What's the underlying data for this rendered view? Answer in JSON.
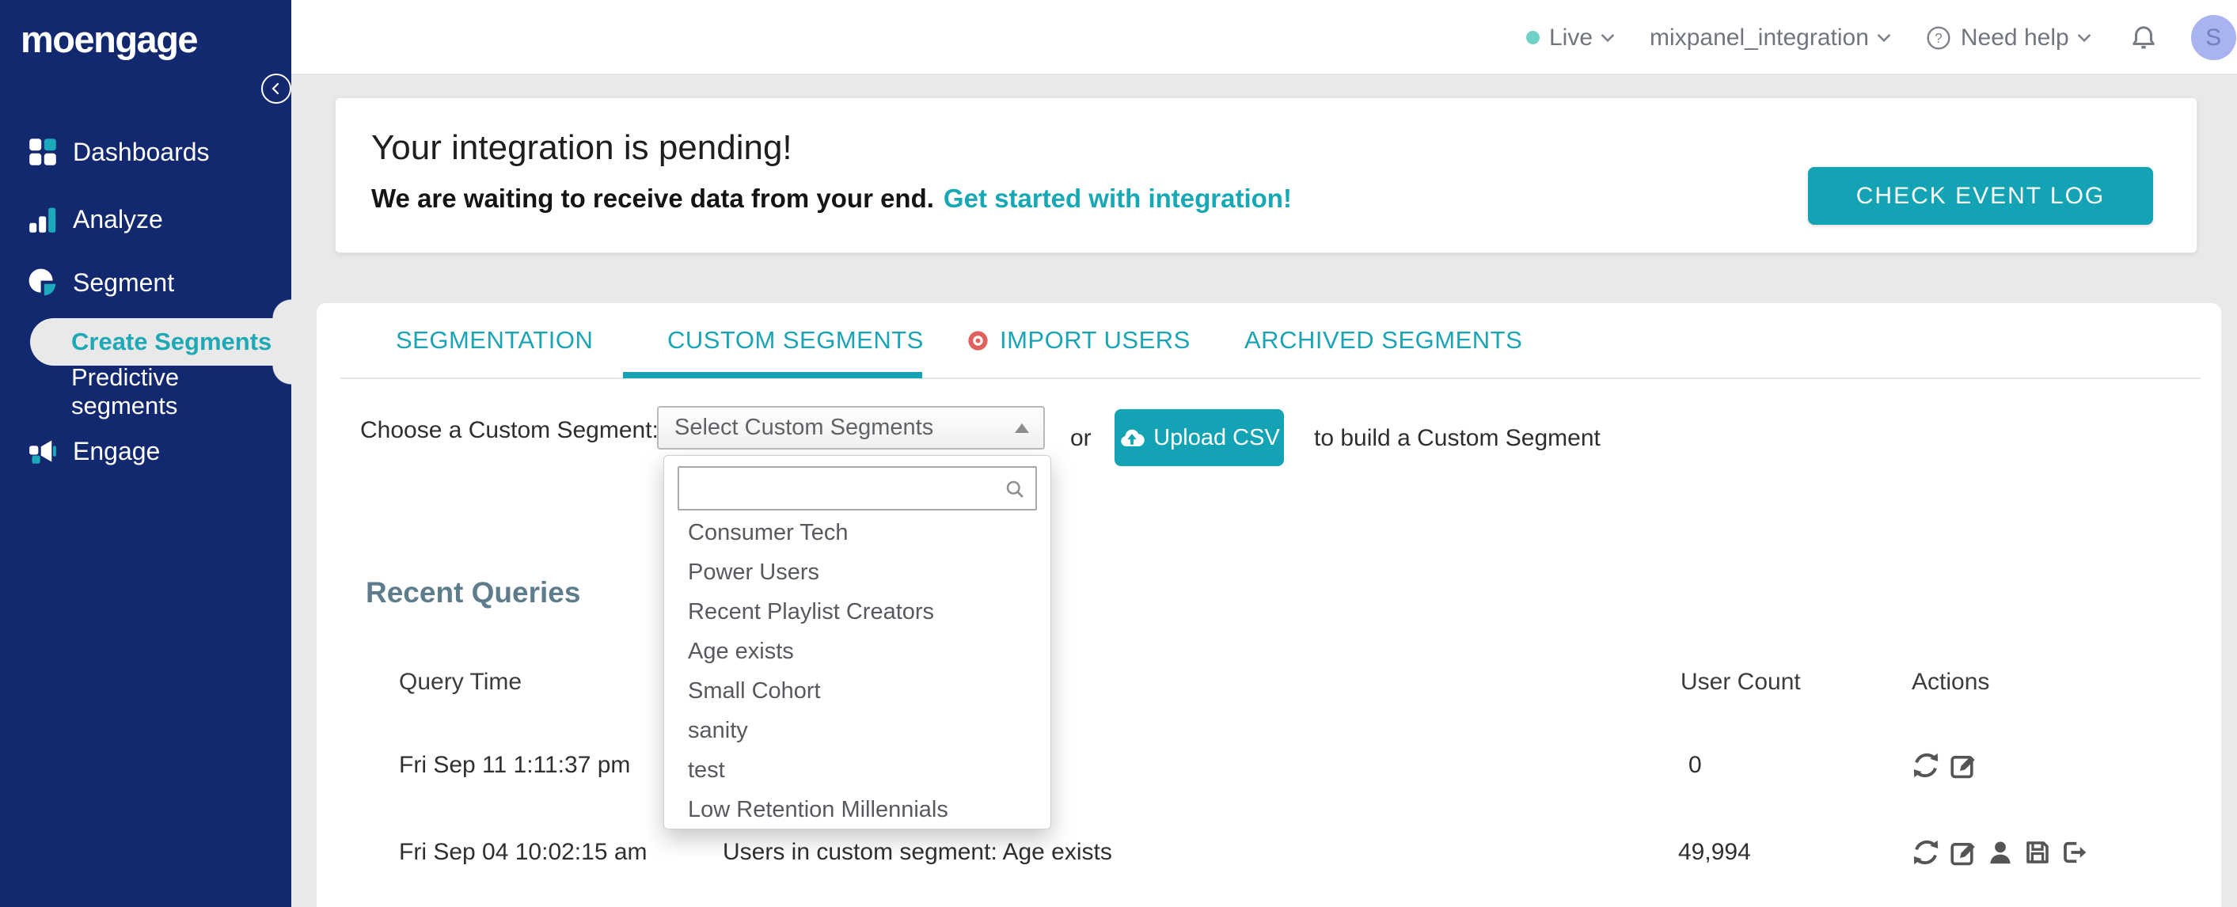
{
  "colors": {
    "navy": "#13296F",
    "teal": "#16A4B4",
    "coral": "#E0625F",
    "page_bg": "#E9E9E9",
    "active_link": "#1FA9B6"
  },
  "logo_text": "moengage",
  "topbar": {
    "environment": "Live",
    "project": "mixpanel_integration",
    "help": "Need help",
    "avatar_initial": "S"
  },
  "sidebar": {
    "items": [
      {
        "label": "Dashboards"
      },
      {
        "label": "Analyze"
      },
      {
        "label": "Segment"
      },
      {
        "label": "Engage"
      }
    ],
    "segment_children": [
      {
        "label": "Create Segments",
        "active": true
      },
      {
        "label": "Predictive segments",
        "active": false
      }
    ]
  },
  "banner": {
    "title": "Your integration is pending!",
    "message": "We are waiting to receive data from your end.",
    "link": "Get started with integration!",
    "button": "CHECK EVENT LOG"
  },
  "tabs": [
    {
      "label": "SEGMENTATION",
      "active": false
    },
    {
      "label": "CUSTOM SEGMENTS",
      "active": true
    },
    {
      "label": "IMPORT USERS",
      "active": false,
      "icon": "red-target"
    },
    {
      "label": "ARCHIVED SEGMENTS",
      "active": false
    }
  ],
  "chooser": {
    "label": "Choose a Custom Segment:",
    "select_value": "Select Custom Segments",
    "or_text": "or",
    "upload_button": "Upload CSV",
    "suffix_text": "to build a Custom Segment",
    "options": [
      "Consumer Tech",
      "Power Users",
      "Recent Playlist Creators",
      "Age exists",
      "Small Cohort",
      "sanity",
      "test",
      "Low Retention Millennials"
    ]
  },
  "recent_queries": {
    "title": "Recent Queries",
    "columns": {
      "query_time": "Query Time",
      "user_count": "User Count",
      "actions": "Actions"
    },
    "rows": [
      {
        "query_time": "Fri Sep 11 1:11:37 pm",
        "user_count": "0",
        "actions": [
          "refresh",
          "edit"
        ]
      },
      {
        "query_time": "Fri Sep 04 10:02:15 am",
        "query": "Users in custom segment: Age exists",
        "user_count": "49,994",
        "actions": [
          "refresh",
          "edit",
          "user",
          "save",
          "export"
        ]
      }
    ]
  }
}
